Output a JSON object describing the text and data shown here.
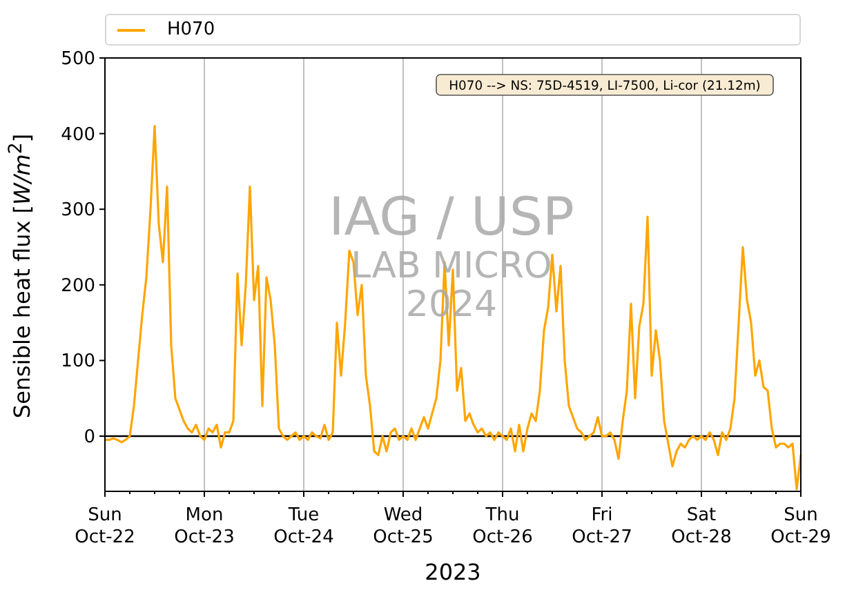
{
  "annotation": "H070 --> NS: 75D-4519, LI-7500, Li-cor (21.12m)",
  "watermark": [
    "IAG / USP",
    "LAB MICRO",
    "2024"
  ],
  "chart_data": {
    "type": "line",
    "xlabel": "2023",
    "ylabel": "Sensible heat flux [*W/m*$^{2}$]",
    "ylim": [
      -73,
      500
    ],
    "yticks": [
      0,
      100,
      200,
      300,
      400,
      500
    ],
    "categories": [
      "Sun Oct-22",
      null,
      null,
      null,
      null,
      null,
      null,
      null,
      null,
      null,
      null,
      null,
      null,
      null,
      null,
      null,
      null,
      null,
      null,
      null,
      null,
      null,
      null,
      null,
      "Mon Oct-23",
      null,
      null,
      null,
      null,
      null,
      null,
      null,
      null,
      null,
      null,
      null,
      null,
      null,
      null,
      null,
      null,
      null,
      null,
      null,
      null,
      null,
      null,
      null,
      "Tue Oct-24",
      null,
      null,
      null,
      null,
      null,
      null,
      null,
      null,
      null,
      null,
      null,
      null,
      null,
      null,
      null,
      null,
      null,
      null,
      null,
      null,
      null,
      null,
      null,
      "Wed Oct-25",
      null,
      null,
      null,
      null,
      null,
      null,
      null,
      null,
      null,
      null,
      null,
      null,
      null,
      null,
      null,
      null,
      null,
      null,
      null,
      null,
      null,
      null,
      null,
      "Thu Oct-26",
      null,
      null,
      null,
      null,
      null,
      null,
      null,
      null,
      null,
      null,
      null,
      null,
      null,
      null,
      null,
      null,
      null,
      null,
      null,
      null,
      null,
      null,
      null,
      "Fri Oct-27",
      null,
      null,
      null,
      null,
      null,
      null,
      null,
      null,
      null,
      null,
      null,
      null,
      null,
      null,
      null,
      null,
      null,
      null,
      null,
      null,
      null,
      null,
      null,
      "Sat Oct-28",
      null,
      null,
      null,
      null,
      null,
      null,
      null,
      null,
      null,
      null,
      null,
      null,
      null,
      null,
      null,
      null,
      null,
      null,
      null,
      null,
      null,
      null,
      null,
      "Sun Oct-29"
    ],
    "series": [
      {
        "name": "H070",
        "color": "#ffa500",
        "values": [
          -5,
          -5,
          -3,
          -5,
          -8,
          -5,
          0,
          40,
          100,
          160,
          210,
          300,
          410,
          280,
          230,
          330,
          120,
          50,
          35,
          20,
          10,
          5,
          15,
          0,
          -5,
          10,
          5,
          15,
          -15,
          5,
          5,
          20,
          215,
          120,
          200,
          330,
          180,
          225,
          40,
          210,
          180,
          120,
          10,
          0,
          -5,
          0,
          5,
          -5,
          0,
          -5,
          5,
          0,
          -3,
          15,
          -5,
          5,
          150,
          80,
          150,
          245,
          230,
          160,
          200,
          80,
          40,
          -20,
          -25,
          0,
          -20,
          5,
          10,
          -5,
          0,
          -5,
          10,
          -5,
          10,
          25,
          10,
          30,
          50,
          100,
          230,
          120,
          220,
          60,
          90,
          20,
          30,
          15,
          5,
          10,
          0,
          5,
          -5,
          5,
          0,
          -5,
          10,
          -20,
          15,
          -20,
          10,
          30,
          20,
          60,
          140,
          170,
          240,
          165,
          225,
          100,
          40,
          25,
          10,
          5,
          -5,
          0,
          5,
          25,
          0,
          0,
          5,
          -5,
          -30,
          20,
          60,
          175,
          50,
          145,
          175,
          290,
          80,
          140,
          100,
          20,
          -10,
          -40,
          -20,
          -10,
          -15,
          -5,
          0,
          -5,
          0,
          -5,
          5,
          -5,
          -25,
          5,
          -5,
          10,
          50,
          150,
          250,
          180,
          150,
          80,
          100,
          65,
          60,
          10,
          -15,
          -10,
          -10,
          -15,
          -10,
          -70,
          -25
        ]
      }
    ]
  }
}
